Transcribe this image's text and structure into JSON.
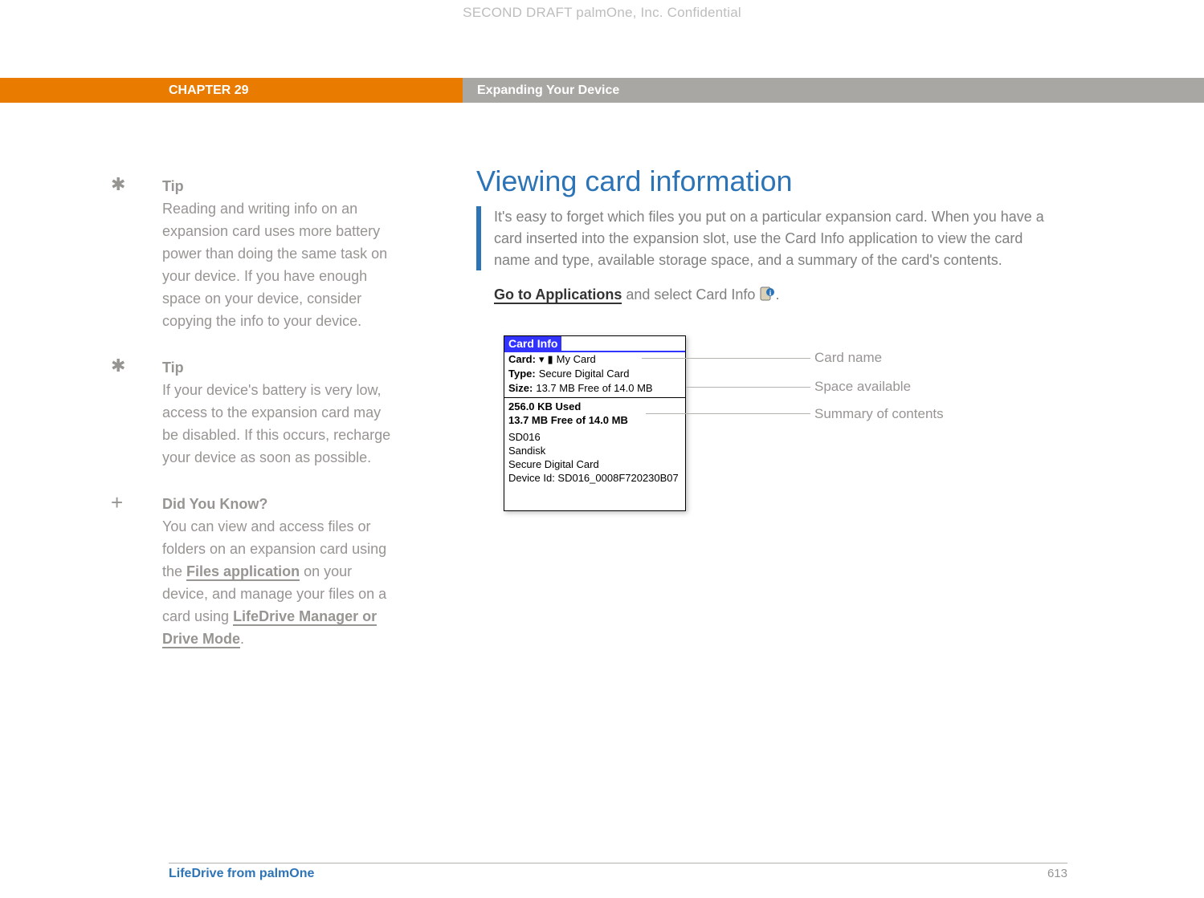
{
  "watermark": "SECOND DRAFT palmOne, Inc.  Confidential",
  "header": {
    "chapter": "CHAPTER 29",
    "title": "Expanding Your Device"
  },
  "sidebar": {
    "tips": [
      {
        "label": "Tip",
        "body": "Reading and writing info on an expansion card uses more battery power than doing the same task on your device. If you have enough space on your device, consider copying the info to your device."
      },
      {
        "label": "Tip",
        "body": "If your device's battery is very low, access to the expansion card may be disabled. If this occurs, recharge your device as soon as possible."
      }
    ],
    "dyk": {
      "label": "Did You Know?",
      "pre": "You can view and access files or folders on an expansion card using the ",
      "link1": "Files application",
      "mid": " on your device, and manage your files on a card using ",
      "link2": "LifeDrive Manager or Drive Mode",
      "post": "."
    }
  },
  "main": {
    "heading": "Viewing card information",
    "intro": "It's easy to forget which files you put on a particular expansion card. When you have a card inserted into the expansion slot, use the Card Info application to view the card name and type, available storage space, and a summary of the card's contents.",
    "instruction_link": "Go to Applications",
    "instruction_rest": " and select Card Info ",
    "instruction_end": "."
  },
  "cardinfo": {
    "title": "Card Info",
    "card_label": "Card:",
    "card_value": "My Card",
    "type_label": "Type:",
    "type_value": "Secure Digital Card",
    "size_label": "Size:",
    "size_value": "13.7 MB Free of 14.0 MB",
    "used": "256.0 KB Used",
    "free": "13.7 MB Free of 14.0 MB",
    "d1": "SD016",
    "d2": "Sandisk",
    "d3": "Secure Digital Card",
    "d4": "Device Id: SD016_0008F720230B07"
  },
  "callouts": {
    "c1": "Card name",
    "c2": "Space available",
    "c3": "Summary of contents"
  },
  "footer": {
    "product": "LifeDrive from palmOne",
    "page": "613"
  }
}
